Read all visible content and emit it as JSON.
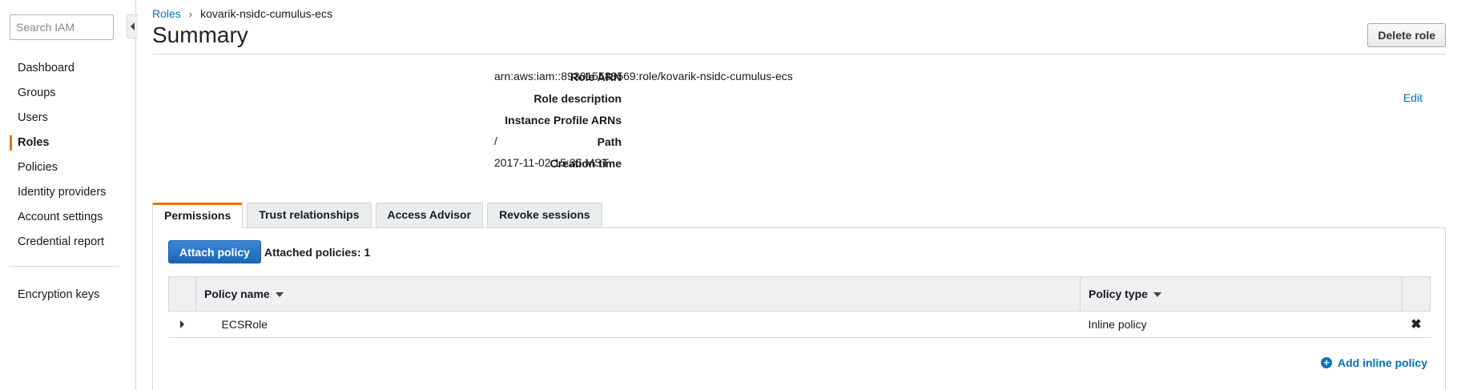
{
  "sidebar": {
    "search_placeholder": "Search IAM",
    "items": [
      {
        "label": "Dashboard"
      },
      {
        "label": "Groups"
      },
      {
        "label": "Users"
      },
      {
        "label": "Roles",
        "active": true
      },
      {
        "label": "Policies"
      },
      {
        "label": "Identity providers"
      },
      {
        "label": "Account settings"
      },
      {
        "label": "Credential report"
      }
    ],
    "secondary_items": [
      {
        "label": "Encryption keys"
      }
    ]
  },
  "breadcrumb": {
    "parent": "Roles",
    "separator": "›",
    "current": "kovarik-nsidc-cumulus-ecs"
  },
  "header": {
    "title": "Summary",
    "delete_label": "Delete role"
  },
  "details": {
    "role_arn": {
      "label": "Role ARN",
      "value": "arn:aws:iam::893015583569:role/kovarik-nsidc-cumulus-ecs"
    },
    "role_description": {
      "label": "Role description",
      "value": "",
      "edit_label": "Edit"
    },
    "instance_profile_arns": {
      "label": "Instance Profile ARNs",
      "value": ""
    },
    "path": {
      "label": "Path",
      "value": "/"
    },
    "creation_time": {
      "label": "Creation time",
      "value": "2017-11-02 15:35 MST"
    }
  },
  "tabs": [
    {
      "label": "Permissions",
      "active": true
    },
    {
      "label": "Trust relationships"
    },
    {
      "label": "Access Advisor"
    },
    {
      "label": "Revoke sessions"
    }
  ],
  "permissions": {
    "attach_label": "Attach policy",
    "attached_text": "Attached policies: 1",
    "columns": {
      "name": "Policy name",
      "type": "Policy type"
    },
    "rows": [
      {
        "name": "ECSRole",
        "type": "Inline policy",
        "remove_icon": "✖"
      }
    ],
    "add_inline_label": "Add inline policy"
  },
  "colors": {
    "accent_orange": "#ec7211",
    "link_blue": "#0073bb",
    "primary_button": "#1d64b7"
  }
}
